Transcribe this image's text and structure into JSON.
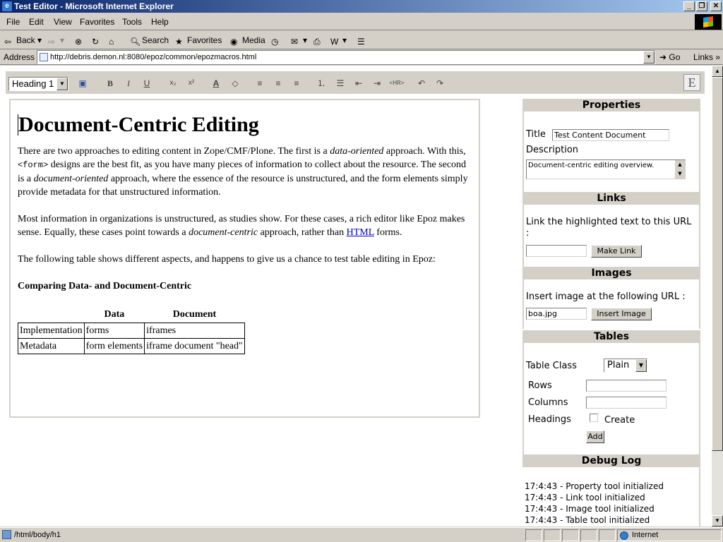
{
  "window": {
    "title": "Test Editor - Microsoft Internet Explorer",
    "buttons": [
      "_",
      "❐",
      "✕"
    ]
  },
  "menubar": {
    "items": [
      "File",
      "Edit",
      "View",
      "Favorites",
      "Tools",
      "Help"
    ]
  },
  "toolbar": {
    "back": "Back",
    "search": "Search",
    "favorites": "Favorites",
    "media": "Media"
  },
  "address": {
    "label": "Address",
    "url": "http://debris.demon.nl:8080/epoz/common/epozmacros.html",
    "go": "Go",
    "links": "Links"
  },
  "editor_toolbar": {
    "style_select": "Heading 1",
    "buttons": {
      "bold": "B",
      "italic": "I",
      "underline": "U",
      "hr": "<HR>"
    }
  },
  "document": {
    "heading": "Document-Centric Editing",
    "p1": {
      "a": "There are two approaches to editing content in Zope/CMF/Plone. The first is a ",
      "b": "data-oriented",
      "c": " approach. With this, ",
      "d": "<form>",
      "e": " designs are the best fit, as you have many pieces of information to collect about the resource. The second is a ",
      "f": "document-oriented",
      "g": " approach, where the essence of the resource is unstructured, and the form elements simply provide metadata for that unstructured information."
    },
    "p2": {
      "a": "Most information in organizations is unstructured, as studies show. For these cases, a rich editor like Epoz makes sense. Equally, these cases point towards a ",
      "b": "document-centric",
      "c": " approach, rather than ",
      "link": "HTML",
      "d": " forms."
    },
    "p3": "The following table shows different aspects, and happens to give us a chance to test table editing in Epoz:",
    "table_title": "Comparing Data- and Document-Centric",
    "table": {
      "headers": [
        "",
        "Data",
        "Document"
      ],
      "rows": [
        [
          "Implementation",
          "forms",
          "iframes"
        ],
        [
          "Metadata",
          "form elements",
          "iframe document \"head\""
        ]
      ]
    }
  },
  "sidebar": {
    "properties": {
      "heading": "Properties",
      "title_label": "Title",
      "title_value": "Test Content Document",
      "description_label": "Description",
      "description_value": "Document-centric editing overview."
    },
    "links": {
      "heading": "Links",
      "text": "Link the highlighted text to this URL :",
      "url_value": "",
      "button": "Make Link"
    },
    "images": {
      "heading": "Images",
      "text": "Insert image at the following URL :",
      "url_value": "boa.jpg",
      "button": "Insert Image"
    },
    "tables": {
      "heading": "Tables",
      "class_label": "Table Class",
      "class_value": "Plain",
      "rows_label": "Rows",
      "columns_label": "Columns",
      "headings_label": "Headings",
      "create_label": "Create",
      "add_button": "Add"
    },
    "debug": {
      "heading": "Debug Log",
      "lines": [
        "17:4:43 - Property tool initialized",
        "17:4:43 - Link tool initialized",
        "17:4:43 - Image tool initialized",
        "17:4:43 - Table tool initialized"
      ]
    }
  },
  "status": {
    "path": "/html/body/h1",
    "zone": "Internet"
  }
}
